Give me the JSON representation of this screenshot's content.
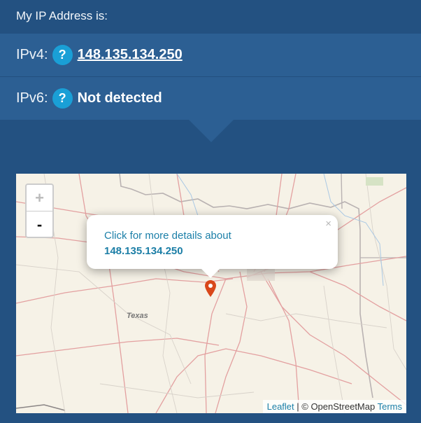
{
  "header": {
    "title": "My IP Address is:"
  },
  "ipv4": {
    "label": "IPv4:",
    "help": "?",
    "value": "148.135.134.250"
  },
  "ipv6": {
    "label": "IPv6:",
    "help": "?",
    "value": "Not detected"
  },
  "map": {
    "zoom_in": "+",
    "zoom_out": "-",
    "region_label": "Texas",
    "popup": {
      "text": "Click for more details about",
      "ip": "148.135.134.250",
      "close": "×"
    },
    "attribution": {
      "leaflet": "Leaflet",
      "separator": " | © OpenStreetMap ",
      "terms": "Terms"
    }
  },
  "colors": {
    "background": "#235181",
    "row": "#2c5f93",
    "badge": "#1a9fd6",
    "marker": "#d9471a"
  }
}
